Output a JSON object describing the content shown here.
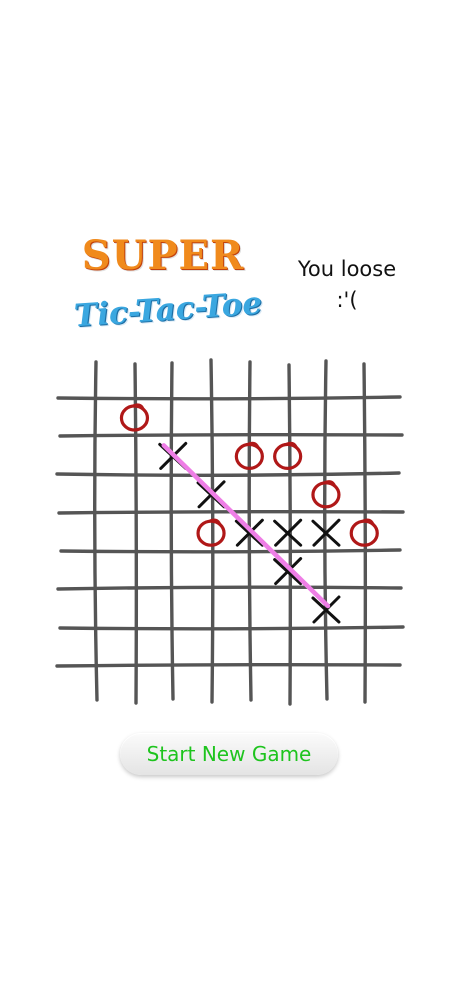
{
  "title": {
    "line1": "SUPER",
    "line2": "Tic-Tac-Toe"
  },
  "status": {
    "line1": "You loose",
    "line2": ":'("
  },
  "board": {
    "columns": 8,
    "rows": 8,
    "cells": [
      {
        "row": 0,
        "col": 1,
        "mark": "O"
      },
      {
        "row": 1,
        "col": 2,
        "mark": "X"
      },
      {
        "row": 1,
        "col": 4,
        "mark": "O"
      },
      {
        "row": 1,
        "col": 5,
        "mark": "O"
      },
      {
        "row": 2,
        "col": 3,
        "mark": "X"
      },
      {
        "row": 2,
        "col": 6,
        "mark": "O"
      },
      {
        "row": 3,
        "col": 3,
        "mark": "O"
      },
      {
        "row": 3,
        "col": 4,
        "mark": "X"
      },
      {
        "row": 3,
        "col": 5,
        "mark": "X"
      },
      {
        "row": 3,
        "col": 6,
        "mark": "X"
      },
      {
        "row": 3,
        "col": 7,
        "mark": "O"
      },
      {
        "row": 4,
        "col": 5,
        "mark": "X"
      },
      {
        "row": 5,
        "col": 6,
        "mark": "X"
      }
    ],
    "winning_line": {
      "from": {
        "row": 1,
        "col": 2
      },
      "to": {
        "row": 5,
        "col": 6
      }
    },
    "colors": {
      "grid": "#555555",
      "x_mark": "#111111",
      "o_mark": "#b01818",
      "win_line": "#ee7ee6"
    }
  },
  "actions": {
    "new_game_label": "Start New Game"
  }
}
